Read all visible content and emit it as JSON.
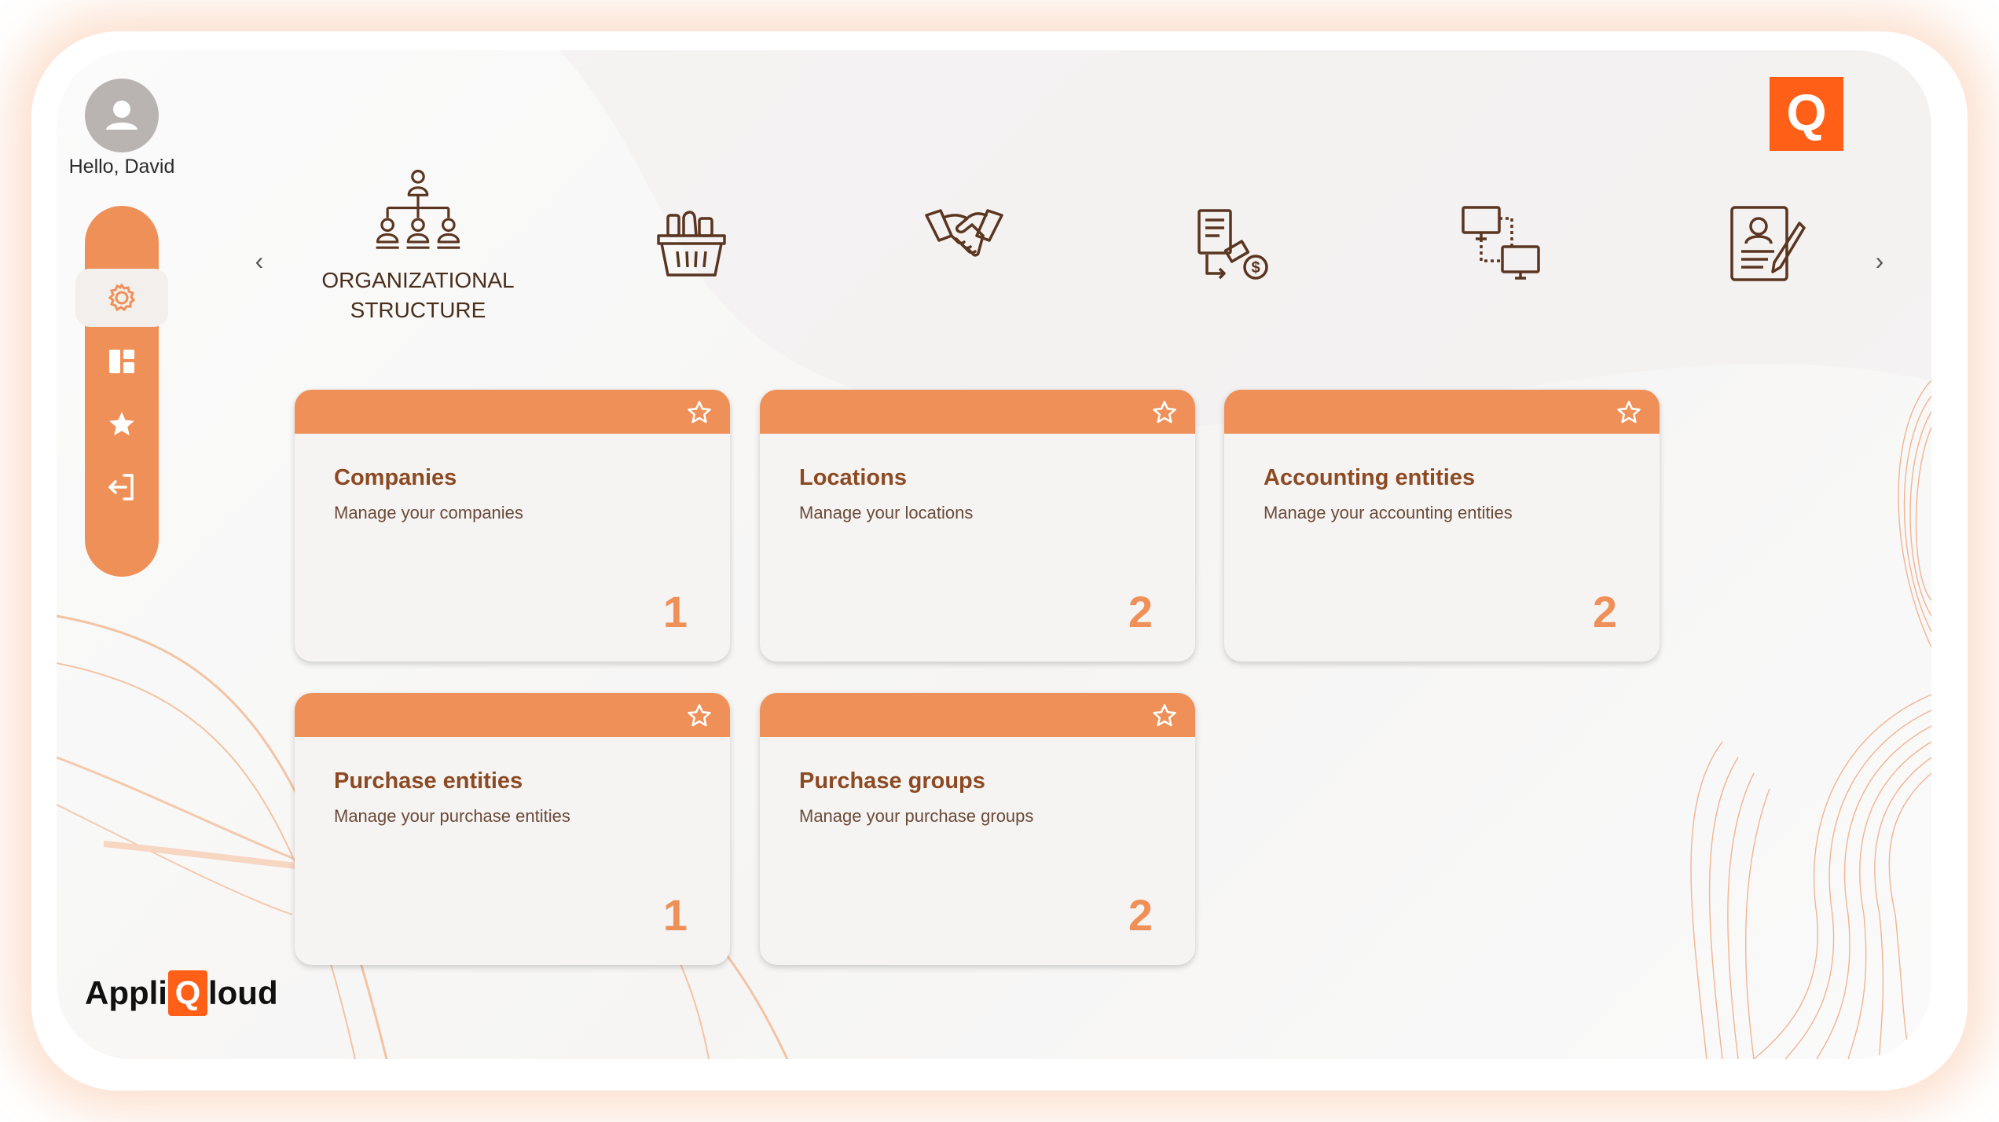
{
  "user": {
    "greeting": "Hello, David",
    "avatar_icon": "user-icon"
  },
  "sidebar": {
    "items": [
      {
        "icon": "gear-icon",
        "active": true
      },
      {
        "icon": "dashboard-icon",
        "active": false
      },
      {
        "icon": "star-icon",
        "active": false
      },
      {
        "icon": "logout-icon",
        "active": false
      }
    ]
  },
  "brand": {
    "prefix": "Appli",
    "q": "Q",
    "suffix": "loud",
    "top_logo": "Q"
  },
  "carousel": {
    "prev_label": "‹",
    "next_label": "›",
    "categories": [
      {
        "icon": "org-chart-icon",
        "label": "ORGANIZATIONAL STRUCTURE"
      },
      {
        "icon": "basket-icon",
        "label": ""
      },
      {
        "icon": "handshake-icon",
        "label": ""
      },
      {
        "icon": "invoice-payment-icon",
        "label": ""
      },
      {
        "icon": "network-computers-icon",
        "label": ""
      },
      {
        "icon": "contract-icon",
        "label": ""
      }
    ]
  },
  "cards": [
    {
      "title": "Companies",
      "subtitle": "Manage your companies",
      "count": "1"
    },
    {
      "title": "Locations",
      "subtitle": "Manage your locations",
      "count": "2"
    },
    {
      "title": "Accounting entities",
      "subtitle": "Manage your accounting entities",
      "count": "2"
    },
    {
      "title": "Purchase entities",
      "subtitle": "Manage your purchase entities",
      "count": "1"
    },
    {
      "title": "Purchase groups",
      "subtitle": "Manage your purchase groups",
      "count": "2"
    }
  ],
  "colors": {
    "accent": "#ee9058",
    "brand": "#ff5f17",
    "title": "#8c4a23"
  }
}
